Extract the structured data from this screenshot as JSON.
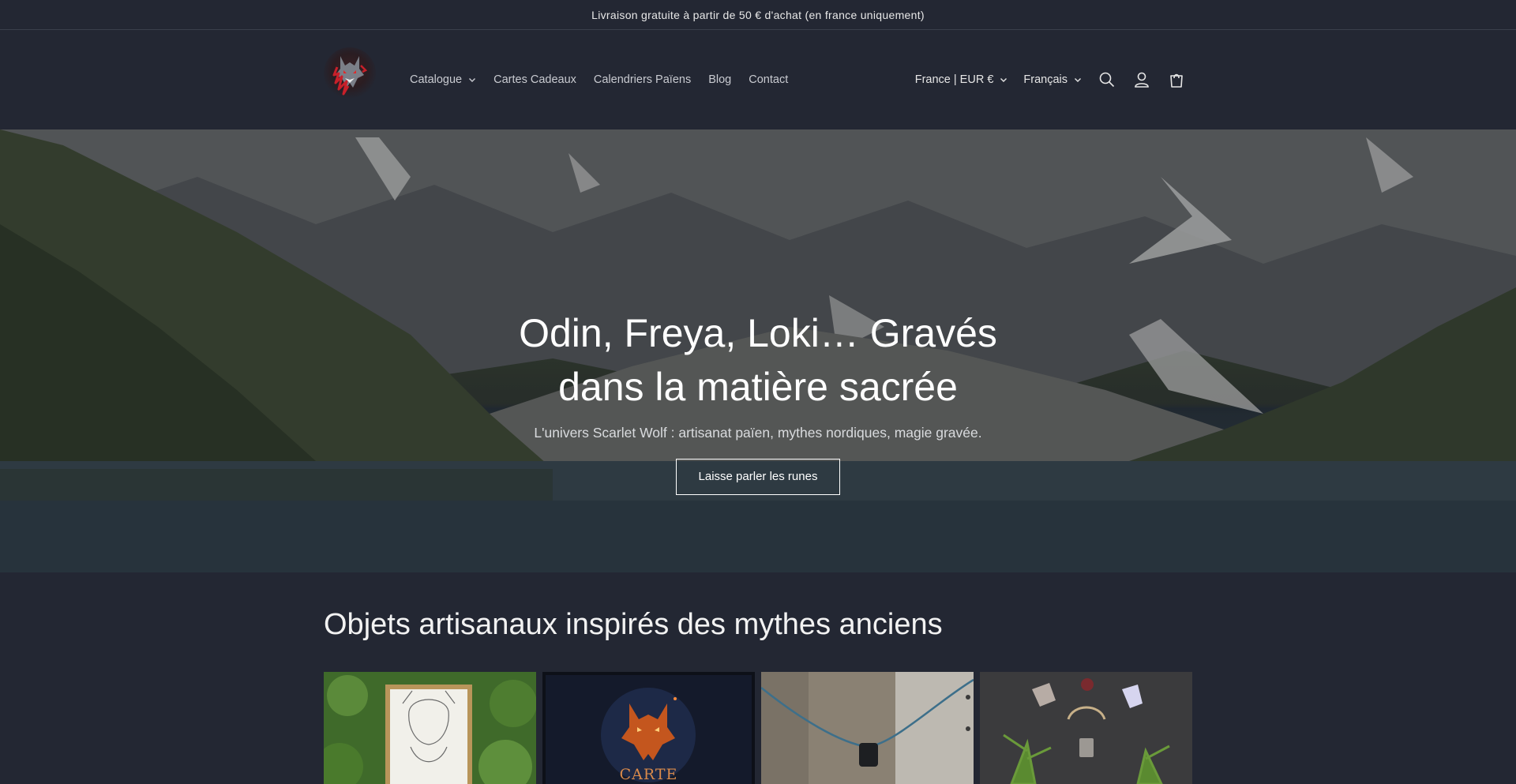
{
  "announcement": {
    "text": "Livraison gratuite à partir de 50 € d'achat (en france uniquement)"
  },
  "header": {
    "logo_alt": "Scarlet Wolf",
    "nav": [
      {
        "label": "Catalogue",
        "has_dropdown": true
      },
      {
        "label": "Cartes Cadeaux",
        "has_dropdown": false
      },
      {
        "label": "Calendriers Païens",
        "has_dropdown": false
      },
      {
        "label": "Blog",
        "has_dropdown": false
      },
      {
        "label": "Contact",
        "has_dropdown": false
      }
    ],
    "country_selector": "France | EUR €",
    "language_selector": "Français",
    "icons": [
      "search-icon",
      "account-icon",
      "cart-icon"
    ]
  },
  "hero": {
    "title": "Odin, Freya, Loki… Gravés dans la matière sacrée",
    "subtitle": "L'univers Scarlet Wolf : artisanat païen, mythes nordiques, magie gravée.",
    "button_label": "Laisse parler les runes"
  },
  "collection": {
    "title": "Objets artisanaux inspirés des mythes anciens",
    "cards": [
      {
        "image": "framed-valkyrie-drawing"
      },
      {
        "image": "wolf-gift-card",
        "overlay_text": "CARTE"
      },
      {
        "image": "stone-pendant-necklace"
      },
      {
        "image": "crystals-and-herbs"
      }
    ]
  },
  "colors": {
    "background": "#232733",
    "text": "#e6e6e6",
    "nav_text": "#c9cbd1",
    "accent_red": "#c8202a",
    "carte_text": "#d98a4a"
  }
}
